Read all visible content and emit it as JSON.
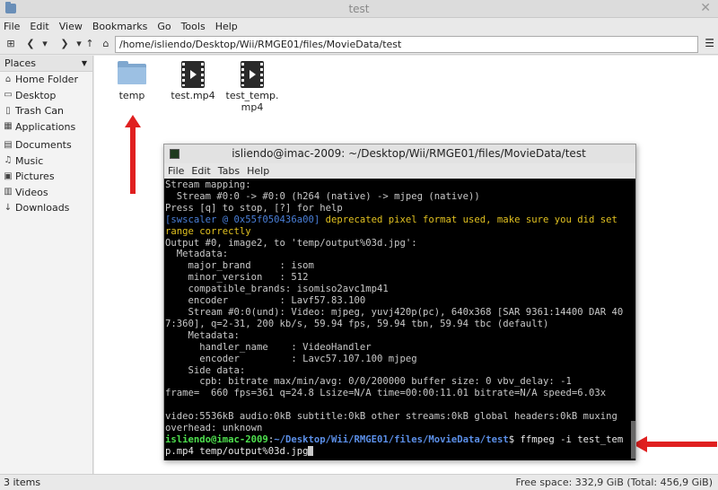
{
  "window": {
    "title": "test"
  },
  "menubar": [
    "File",
    "Edit",
    "View",
    "Bookmarks",
    "Go",
    "Tools",
    "Help"
  ],
  "location": {
    "path": "/home/isliendo/Desktop/Wii/RMGE01/files/MovieData/test"
  },
  "sidebar": {
    "header": "Places",
    "items": [
      {
        "label": "Home Folder",
        "icon": "home-icon"
      },
      {
        "label": "Desktop",
        "icon": "desktop-icon"
      },
      {
        "label": "Trash Can",
        "icon": "trash-icon"
      },
      {
        "label": "Applications",
        "icon": "applications-icon"
      }
    ],
    "items2": [
      {
        "label": "Documents",
        "icon": "documents-icon"
      },
      {
        "label": "Music",
        "icon": "music-icon"
      },
      {
        "label": "Pictures",
        "icon": "pictures-icon"
      },
      {
        "label": "Videos",
        "icon": "videos-icon"
      },
      {
        "label": "Downloads",
        "icon": "downloads-icon"
      }
    ]
  },
  "files": [
    {
      "name": "temp",
      "type": "folder"
    },
    {
      "name": "test.mp4",
      "type": "video"
    },
    {
      "name": "test_temp.\nmp4",
      "type": "video"
    }
  ],
  "terminal": {
    "title": "isliendo@imac-2009: ~/Desktop/Wii/RMGE01/files/MovieData/test",
    "menu": [
      "File",
      "Edit",
      "Tabs",
      "Help"
    ],
    "lines_before": [
      "Stream mapping:",
      "  Stream #0:0 -> #0:0 (h264 (native) -> mjpeg (native))",
      "Press [q] to stop, [?] for help"
    ],
    "warn_prefix": "[swscaler @ 0x55f050436a00] ",
    "warn_text": "deprecated pixel format used, make sure you did set",
    "warn_text2": "range correctly",
    "lines_after": [
      "Output #0, image2, to 'temp/output%03d.jpg':",
      "  Metadata:",
      "    major_brand     : isom",
      "    minor_version   : 512",
      "    compatible_brands: isomiso2avc1mp41",
      "    encoder         : Lavf57.83.100",
      "    Stream #0:0(und): Video: mjpeg, yuvj420p(pc), 640x368 [SAR 9361:14400 DAR 40",
      "7:360], q=2-31, 200 kb/s, 59.94 fps, 59.94 tbn, 59.94 tbc (default)",
      "    Metadata:",
      "      handler_name    : VideoHandler",
      "      encoder         : Lavc57.107.100 mjpeg",
      "    Side data:",
      "      cpb: bitrate max/min/avg: 0/0/200000 buffer size: 0 vbv_delay: -1",
      "frame=  660 fps=361 q=24.8 Lsize=N/A time=00:00:11.01 bitrate=N/A speed=6.03x",
      "",
      "video:5536kB audio:0kB subtitle:0kB other streams:0kB global headers:0kB muxing",
      "overhead: unknown"
    ],
    "prompt_user": "isliendo@imac-2009",
    "prompt_path": "~/Desktop/Wii/RMGE01/files/MovieData/test",
    "prompt_cmd": "$ ffmpeg -i test_tem",
    "prompt_cmd2": "p.mp4 temp/output%03d.jpg"
  },
  "status": {
    "items": "3 items",
    "free_space": "Free space: 332,9 GiB (Total: 456,9 GiB)"
  },
  "colors": {
    "annotation_arrow": "#e02020",
    "terminal_bg": "#000000"
  }
}
